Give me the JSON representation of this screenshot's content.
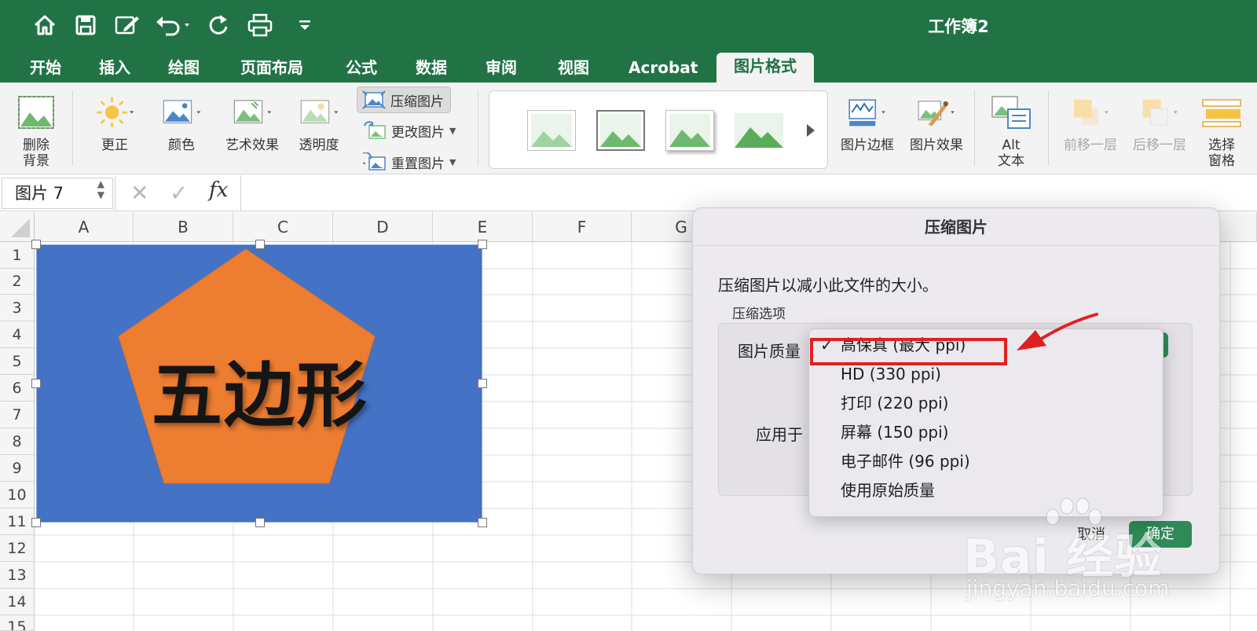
{
  "quick_access": {
    "home_icon": "home-icon",
    "save_icon": "save-icon",
    "edit_icon": "edit-icon",
    "undo_icon": "undo-icon",
    "redo_icon": "redo-icon",
    "print_icon": "print-icon",
    "customize_icon": "chevron-down-icon"
  },
  "document": {
    "title": "工作簿2"
  },
  "tabs": [
    "开始",
    "插入",
    "绘图",
    "页面布局",
    "公式",
    "数据",
    "审阅",
    "视图",
    "Acrobat",
    "图片格式"
  ],
  "active_tab": "图片格式",
  "ribbon": {
    "remove_bg": [
      "删除",
      "背景"
    ],
    "corrections": "更正",
    "color": "颜色",
    "artistic": "艺术效果",
    "transparency": "透明度",
    "compress": "压缩图片",
    "change": "更改图片",
    "reset": "重置图片",
    "border": "图片边框",
    "effects": "图片效果",
    "alt_text": [
      "Alt",
      "文本"
    ],
    "bring_forward": "前移一层",
    "send_backward": "后移一层",
    "selection_pane": [
      "选择",
      "窗格"
    ]
  },
  "formula_bar": {
    "name_box": "图片 7",
    "cancel": "✕",
    "enter": "✓",
    "fx": "fx"
  },
  "sheet": {
    "columns": [
      "A",
      "B",
      "C",
      "D",
      "E",
      "F",
      "G"
    ],
    "rows": [
      "1",
      "2",
      "3",
      "4",
      "5",
      "6",
      "7",
      "8",
      "9",
      "10",
      "11",
      "12",
      "13",
      "14",
      "15"
    ]
  },
  "picture": {
    "text": "五边形",
    "bg_color": "#4472c4",
    "shape_color": "#ed7d31"
  },
  "dialog": {
    "title": "压缩图片",
    "description": "压缩图片以减小此文件的大小。",
    "section": "压缩选项",
    "quality_label": "图片质量",
    "apply_label": "应用于",
    "cancel": "取消",
    "ok": "确定",
    "menu_items": [
      {
        "label": "高保真 (最大 ppi)",
        "checked": true
      },
      {
        "label": "HD (330 ppi)",
        "checked": false
      },
      {
        "label": "打印 (220 ppi)",
        "checked": false
      },
      {
        "label": "屏幕 (150 ppi)",
        "checked": false
      },
      {
        "label": "电子邮件 (96 ppi)",
        "checked": false
      },
      {
        "label": "使用原始质量",
        "checked": false
      }
    ],
    "check_mark": "✓"
  },
  "watermark": {
    "brand": "Bai 经验",
    "url": "jingyan.baidu.com"
  },
  "colors": {
    "excel_green": "#217346",
    "highlight_red": "#e02020",
    "arrow_red": "#e02020",
    "ok_green": "#2e8b57"
  }
}
